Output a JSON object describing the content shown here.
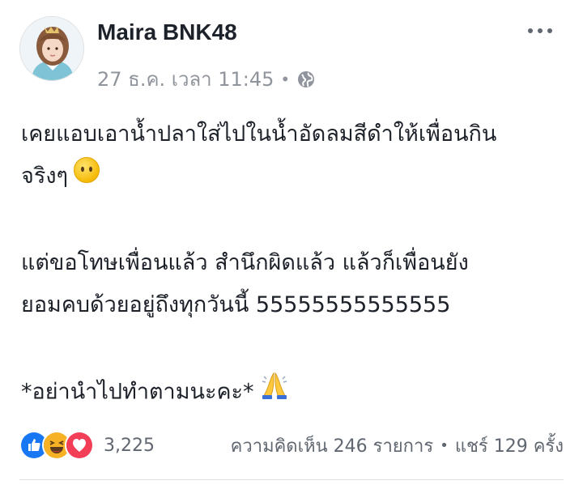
{
  "post": {
    "author": "Maira BNK48",
    "timestamp": "27 ธ.ค. เวลา 11:45",
    "separator": "•",
    "privacy_icon": "globe-icon",
    "more_icon": "more-options-icon",
    "lines": [
      "เคยแอบเอาน้ำปลาใส่ไปในน้ำอัดลมสีดำให้เพื่อนกิน",
      "จริงๆ",
      "แต่ขอโทษเพื่อนแล้ว สำนึกผิดแล้ว แล้วก็เพื่อนยัง",
      "ยอมคบด้วยอยู่ถึงทุกวันนี้ 55555555555555",
      "*อย่านำไปทำตามนะคะ*"
    ],
    "emojis": [
      "no-mouth-face-emoji",
      "folded-hands-emoji"
    ]
  },
  "footer": {
    "reaction_icons": [
      "like-icon",
      "haha-icon",
      "love-icon"
    ],
    "reaction_count": "3,225",
    "comments": "ความคิดเห็น 246 รายการ",
    "separator": "•",
    "shares": "แชร์ 129 ครั้ง"
  },
  "colors": {
    "text": "#1d2129",
    "meta": "#90949c",
    "like_blue": "#1877f2",
    "love_red": "#f33e58",
    "haha_yellow": "#f7b125"
  }
}
